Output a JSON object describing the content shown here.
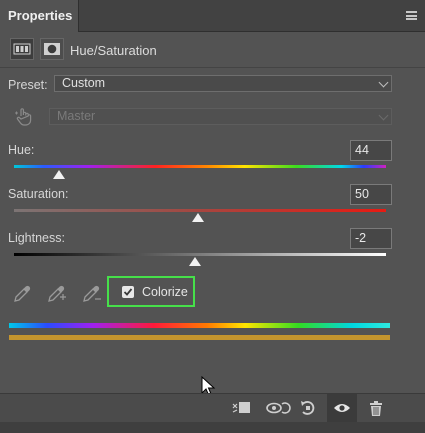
{
  "panel": {
    "title": "Properties"
  },
  "adjustment": {
    "title": "Hue/Saturation",
    "icons": [
      "adjustment-layer-icon",
      "mask-icon"
    ]
  },
  "preset": {
    "label": "Preset:",
    "value": "Custom"
  },
  "channel": {
    "value": "Master"
  },
  "hue": {
    "label": "Hue:",
    "value": "44",
    "min": -180,
    "max": 180
  },
  "saturation": {
    "label": "Saturation:",
    "value": "50",
    "min": -100,
    "max": 100
  },
  "lightness": {
    "label": "Lightness:",
    "value": "-2",
    "min": -100,
    "max": 100
  },
  "colorize": {
    "label": "Colorize",
    "checked": true
  },
  "colors": {
    "colorize_bar": "#c4952e",
    "highlight": "#46e04a"
  },
  "toolbar": {
    "icons": [
      "clip-to-layer-icon",
      "view-previous-state-icon",
      "reset-icon",
      "visibility-eye-icon",
      "delete-trash-icon"
    ]
  }
}
